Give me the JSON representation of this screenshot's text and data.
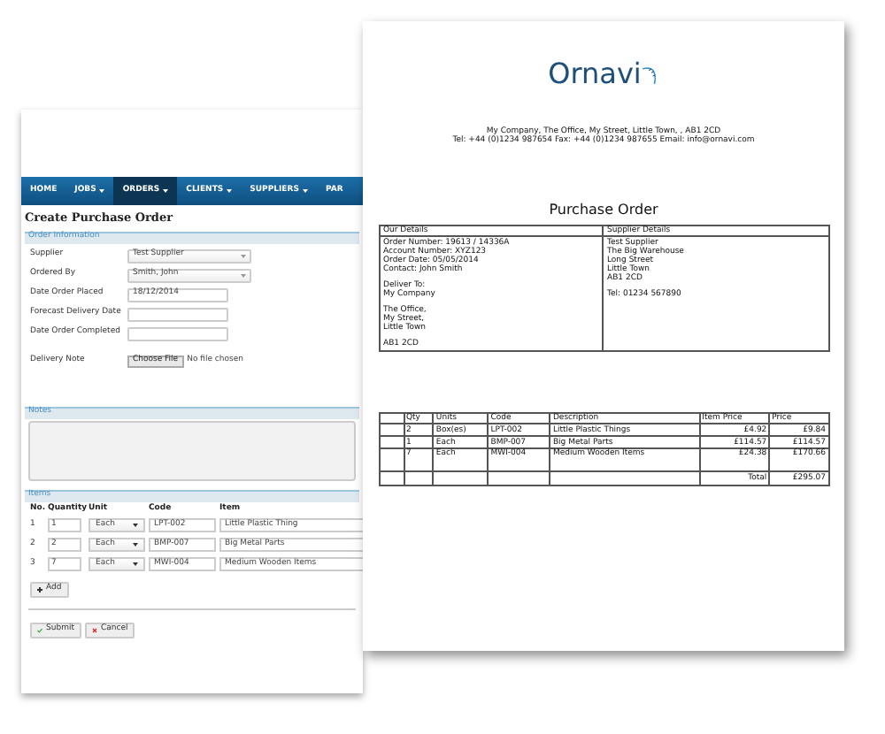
{
  "app": {
    "nav": [
      {
        "label": "HOME",
        "dropdown": false,
        "selected": false
      },
      {
        "label": "JOBS",
        "dropdown": true,
        "selected": false
      },
      {
        "label": "ORDERS",
        "dropdown": true,
        "selected": true
      },
      {
        "label": "CLIENTS",
        "dropdown": true,
        "selected": false
      },
      {
        "label": "SUPPLIERS",
        "dropdown": true,
        "selected": false
      },
      {
        "label": "PAR",
        "dropdown": false,
        "selected": false
      }
    ],
    "title": "Create Purchase Order",
    "order_information": {
      "heading": "Order Information",
      "fields": [
        {
          "label": "Supplier",
          "kind": "select",
          "value": "Test Supplier"
        },
        {
          "label": "Ordered By",
          "kind": "select",
          "value": "Smith, John"
        },
        {
          "label": "Date Order Placed",
          "kind": "text",
          "value": "18/12/2014"
        },
        {
          "label": "Forecast Delivery Date",
          "kind": "text"
        },
        {
          "label": "Date Order Completed",
          "kind": "text"
        },
        {
          "label": "Delivery Note",
          "kind": "file",
          "button": "Choose File",
          "value": "No file chosen"
        }
      ]
    },
    "notes": {
      "heading": "Notes"
    },
    "items": {
      "heading": "Items",
      "columns": [
        "No.",
        "Quantity",
        "Unit",
        "Code",
        "Item"
      ],
      "rows": [
        {
          "no": "1",
          "quantity": "1",
          "unit": "Each",
          "code": "LPT-002",
          "item": "Little Plastic Thing"
        },
        {
          "no": "2",
          "quantity": "2",
          "unit": "Each",
          "code": "BMP-007",
          "item": "Big Metal Parts"
        },
        {
          "no": "3",
          "quantity": "7",
          "unit": "Each",
          "code": "MWI-004",
          "item": "Medium Wooden Items"
        }
      ]
    },
    "add_button": "Add",
    "buttons": [
      {
        "label": "Submit",
        "kind": "submit"
      },
      {
        "label": "Cancel",
        "kind": "cancel"
      }
    ]
  },
  "document": {
    "logo": "Ornavi",
    "address_lines": [
      "My Company, The Office, My Street, Little Town, , AB1 2CD",
      "Tel: +44 (0)1234 987654 Fax: +44 (0)1234 987655 Email: info@ornavi.com"
    ],
    "title": "Purchase Order",
    "our_details": {
      "heading": "Our Details",
      "blocks": [
        [
          "Order Number: 19613 / 14336A",
          "Account Number: XYZ123",
          "Order Date: 05/05/2014",
          "Contact: John Smith"
        ],
        [
          "Deliver To:",
          "My Company"
        ],
        [
          "The Office,",
          "My Street,",
          "Little Town"
        ],
        [
          "AB1 2CD"
        ]
      ]
    },
    "supplier_details": {
      "heading": "Supplier Details",
      "blocks": [
        [
          "Test Supplier",
          "The Big Warehouse",
          "Long Street",
          "Little Town",
          "AB1 2CD"
        ],
        [
          "Tel: 01234 567890"
        ]
      ]
    },
    "items": {
      "columns": [
        "Qty",
        "Units",
        "Code",
        "Description",
        "Item Price",
        "Price"
      ],
      "rows": [
        {
          "qty": "2",
          "units": "Box(es)",
          "code": "LPT-002",
          "description": "Little Plastic Things",
          "item_price": "£4.92",
          "price": "£9.84"
        },
        {
          "qty": "1",
          "units": "Each",
          "code": "BMP-007",
          "description": "Big Metal Parts",
          "item_price": "£114.57",
          "price": "£114.57"
        },
        {
          "qty": "7",
          "units": "Each",
          "code": "MWI-004",
          "description": "Medium Wooden Items",
          "item_price": "£24.38",
          "price": "£170.66"
        }
      ],
      "total_label": "Total",
      "total": "£295.07"
    }
  }
}
